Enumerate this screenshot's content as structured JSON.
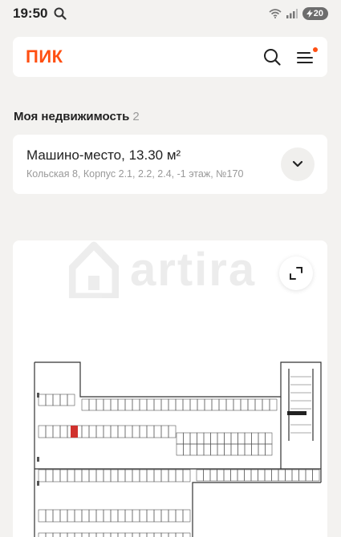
{
  "status": {
    "time": "19:50",
    "battery": "20"
  },
  "header": {
    "logo": "ПИК"
  },
  "section": {
    "title": "Моя недвижимость",
    "count": "2"
  },
  "property": {
    "title": "Машино-место, 13.30 м²",
    "subtitle": "Кольская 8, Корпус 2.1, 2.2, 2.4, -1 этаж, №170"
  },
  "plan": {
    "watermark": "artira",
    "highlight_color": "#d0312d"
  }
}
